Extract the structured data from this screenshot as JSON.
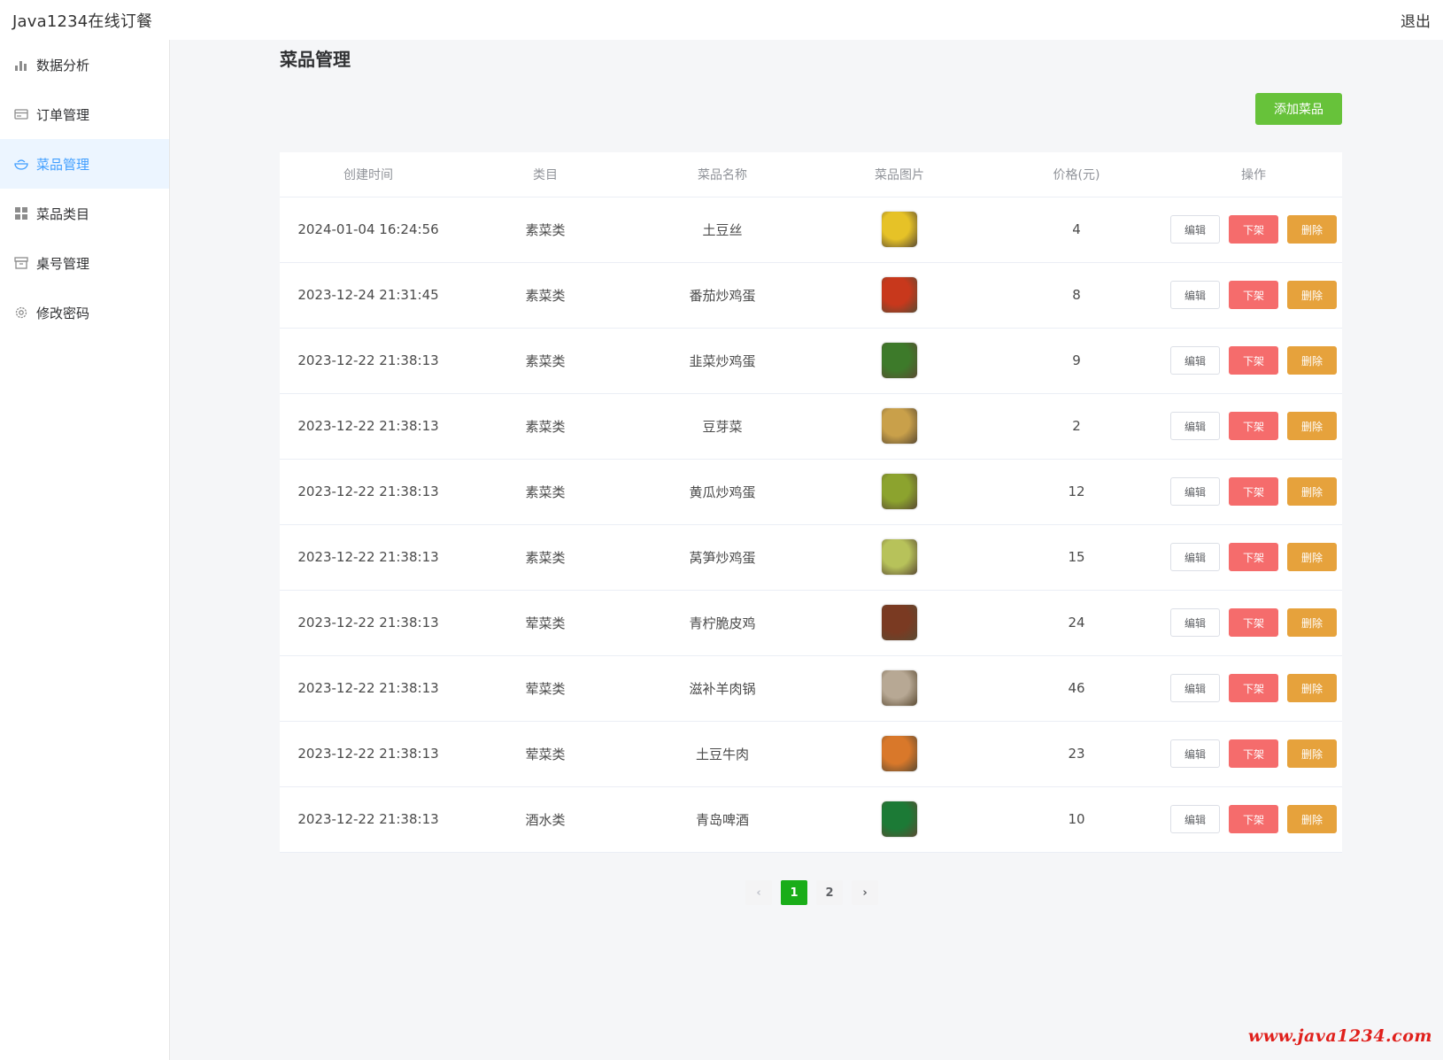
{
  "app": {
    "title": "Java1234在线订餐",
    "logout": "退出"
  },
  "sidebar": {
    "items": [
      {
        "label": "数据分析",
        "icon": "bar-chart-icon"
      },
      {
        "label": "订单管理",
        "icon": "card-icon"
      },
      {
        "label": "菜品管理",
        "icon": "bowl-icon",
        "active": true
      },
      {
        "label": "菜品类目",
        "icon": "grid-icon"
      },
      {
        "label": "桌号管理",
        "icon": "box-icon"
      },
      {
        "label": "修改密码",
        "icon": "gear-icon"
      }
    ]
  },
  "page": {
    "title": "菜品管理",
    "add_button": "添加菜品"
  },
  "table": {
    "headers": [
      "创建时间",
      "类目",
      "菜品名称",
      "菜品图片",
      "价格(元)",
      "操作"
    ],
    "actions": {
      "edit": "编辑",
      "off": "下架",
      "delete": "删除"
    },
    "rows": [
      {
        "time": "2024-01-04 16:24:56",
        "category": "素菜类",
        "name": "土豆丝",
        "price": "4",
        "img_color": "#e6c227"
      },
      {
        "time": "2023-12-24 21:31:45",
        "category": "素菜类",
        "name": "番茄炒鸡蛋",
        "price": "8",
        "img_color": "#c8381c"
      },
      {
        "time": "2023-12-22 21:38:13",
        "category": "素菜类",
        "name": "韭菜炒鸡蛋",
        "price": "9",
        "img_color": "#3d7a2a"
      },
      {
        "time": "2023-12-22 21:38:13",
        "category": "素菜类",
        "name": "豆芽菜",
        "price": "2",
        "img_color": "#c9a04a"
      },
      {
        "time": "2023-12-22 21:38:13",
        "category": "素菜类",
        "name": "黄瓜炒鸡蛋",
        "price": "12",
        "img_color": "#8ca32e"
      },
      {
        "time": "2023-12-22 21:38:13",
        "category": "素菜类",
        "name": "莴笋炒鸡蛋",
        "price": "15",
        "img_color": "#b7c25a"
      },
      {
        "time": "2023-12-22 21:38:13",
        "category": "荤菜类",
        "name": "青柠脆皮鸡",
        "price": "24",
        "img_color": "#7a3a22"
      },
      {
        "time": "2023-12-22 21:38:13",
        "category": "荤菜类",
        "name": "滋补羊肉锅",
        "price": "46",
        "img_color": "#b7a894"
      },
      {
        "time": "2023-12-22 21:38:13",
        "category": "荤菜类",
        "name": "土豆牛肉",
        "price": "23",
        "img_color": "#d9782a"
      },
      {
        "time": "2023-12-22 21:38:13",
        "category": "酒水类",
        "name": "青岛啤酒",
        "price": "10",
        "img_color": "#1c7a36"
      }
    ]
  },
  "pagination": {
    "prev": "‹",
    "pages": [
      "1",
      "2"
    ],
    "current": "1",
    "next": "›"
  },
  "watermark": "www.java1234.com",
  "colors": {
    "accent": "#409eff",
    "success": "#67c23a",
    "danger": "#f56c6c",
    "warning": "#e6a23c",
    "page_active": "#1aad19"
  }
}
